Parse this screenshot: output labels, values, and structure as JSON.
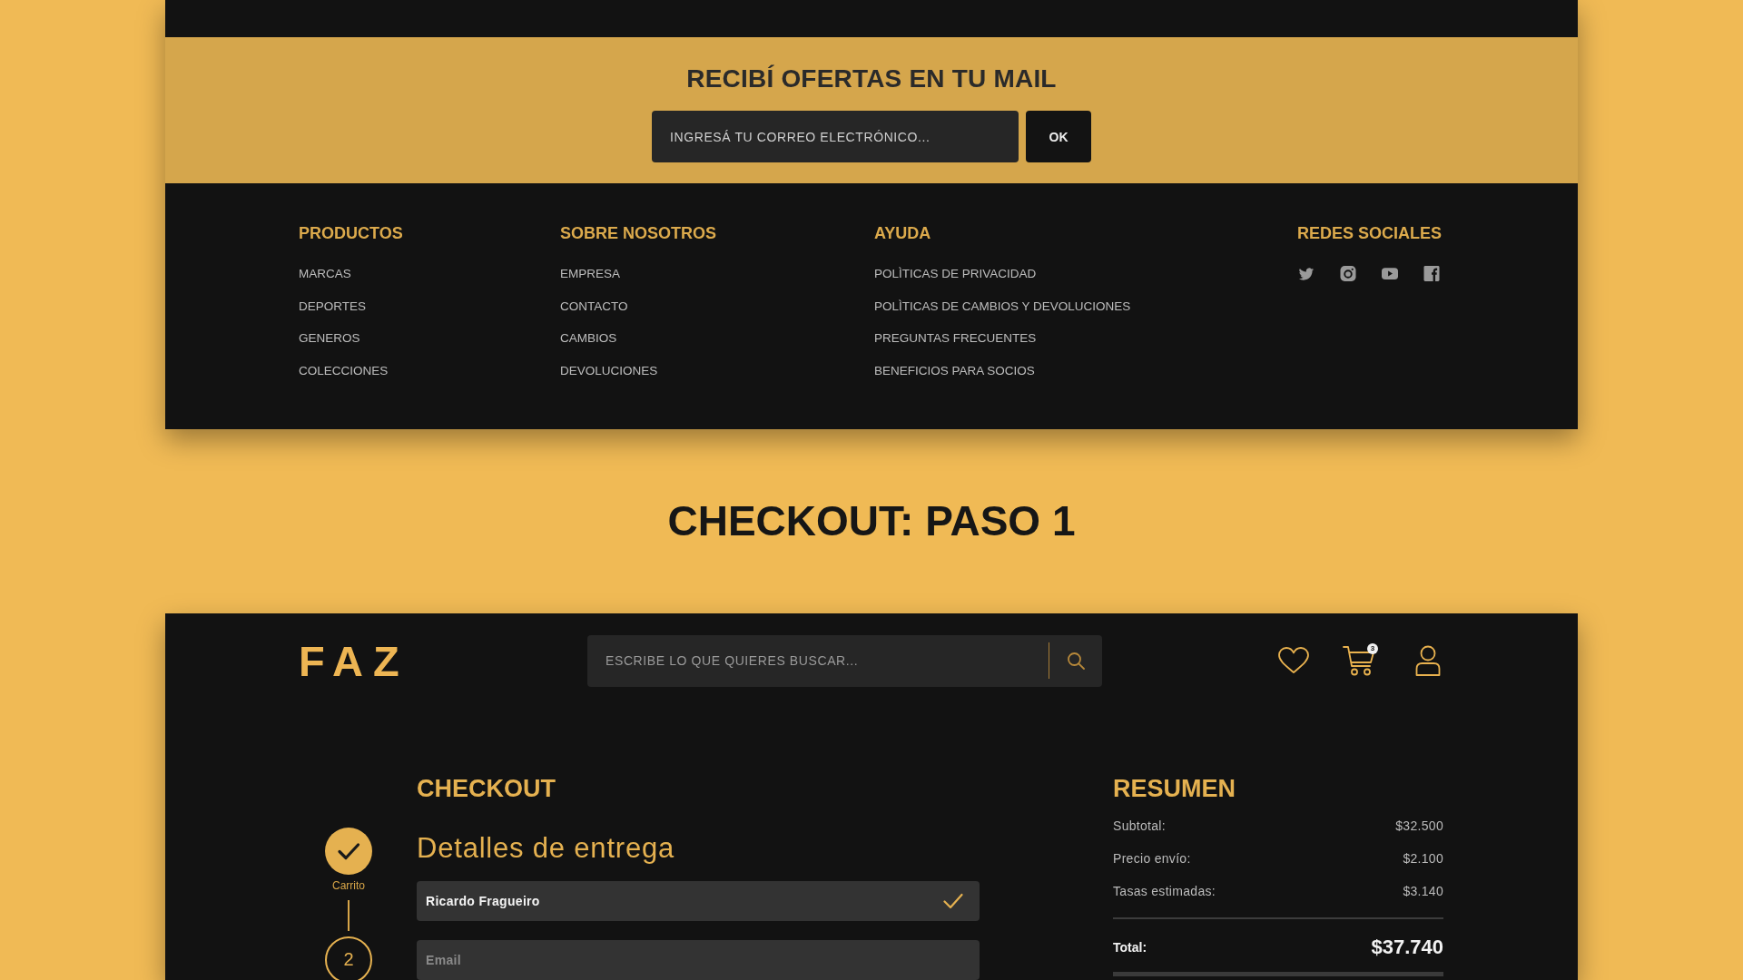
{
  "newsletter": {
    "title": "RECIBÍ OFERTAS EN TU MAIL",
    "email_field": {
      "placeholder": "INGRESÁ TU CORREO ELECTRÓNICO..."
    },
    "submit_button": "OK"
  },
  "footer": {
    "columns": [
      {
        "heading": "PRODUCTOS",
        "links": [
          "MARCAS",
          "DEPORTES",
          "GENEROS",
          "COLECCIONES"
        ]
      },
      {
        "heading": "SOBRE NOSOTROS",
        "links": [
          "EMPRESA",
          "CONTACTO",
          "CAMBIOS",
          "DEVOLUCIONES"
        ]
      },
      {
        "heading": "AYUDA",
        "links": [
          "POLÌTICAS DE PRIVACIDAD",
          "POLÌTICAS DE CAMBIOS Y DEVOLUCIONES",
          "PREGUNTAS FRECUENTES",
          "BENEFICIOS PARA SOCIOS"
        ]
      }
    ],
    "social_heading": "REDES SOCIALES"
  },
  "page_title": "CHECKOUT: PASO 1",
  "header": {
    "logo": "FAZ",
    "search": {
      "placeholder": "ESCRIBE LO QUE QUIERES BUSCAR..."
    },
    "cart_count": "3"
  },
  "checkout": {
    "title": "CHECKOUT",
    "steps": [
      {
        "label": "Carrito",
        "done": true
      },
      {
        "number": "2",
        "done": false
      }
    ],
    "section_title": "Detalles de entrega",
    "fields": [
      {
        "value": "Ricardo Fragueiro",
        "valid": true
      },
      {
        "placeholder": "Email",
        "valid": false
      }
    ]
  },
  "summary": {
    "title": "RESUMEN",
    "rows": [
      {
        "label": "Subtotal:",
        "value": "$32.500"
      },
      {
        "label": "Precio envío:",
        "value": "$2.100"
      },
      {
        "label": "Tasas estimadas:",
        "value": "$3.140"
      }
    ],
    "total": {
      "label": "Total:",
      "value": "$37.740"
    }
  }
}
